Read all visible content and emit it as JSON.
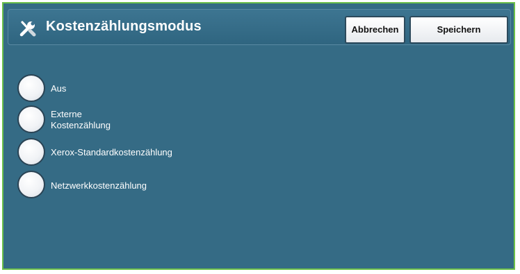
{
  "header": {
    "title": "Kostenzählungsmodus",
    "icon": "tools-icon"
  },
  "actions": {
    "cancel_label": "Abbrechen",
    "save_label": "Speichern"
  },
  "options": [
    {
      "label_line1": "Aus",
      "label_line2": "",
      "selected": false
    },
    {
      "label_line1": "Externe",
      "label_line2": "Kostenzählung",
      "selected": false
    },
    {
      "label_line1": "Xerox-Standardkostenzählung",
      "label_line2": "",
      "selected": false
    },
    {
      "label_line1": "Netzwerkkostenzählung",
      "label_line2": "",
      "selected": false
    }
  ],
  "colors": {
    "panel_background": "#356b85",
    "frame_border": "#6cc04a",
    "button_background": "#ffffff",
    "text": "#ffffff"
  }
}
